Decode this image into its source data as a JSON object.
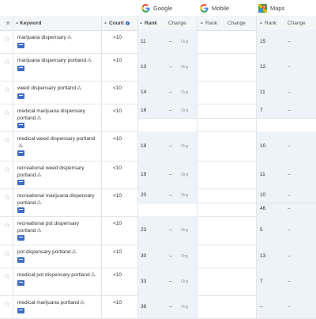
{
  "engines": [
    {
      "name": "Google",
      "icon": "google-icon"
    },
    {
      "name": "Mobile",
      "icon": "google-icon"
    },
    {
      "name": "Maps",
      "icon": "maps-icon"
    }
  ],
  "headers": {
    "keyword": "Keyword",
    "count": "Count",
    "google_rank": "Rank",
    "google_change": "Change",
    "mobile_rank": "Rank",
    "mobile_change": "Change",
    "maps_rank": "Rank",
    "maps_change": "Change"
  },
  "rows": [
    {
      "keyword": "marijuana dispensary",
      "count": "<10",
      "google_rank": "11",
      "google_change": "–",
      "google_type": "Org",
      "maps_rank": "15",
      "maps_change": "–"
    },
    {
      "keyword": "marijuana dispensary portland",
      "count": "<10",
      "google_rank": "13",
      "google_change": "–",
      "google_type": "Org",
      "maps_rank": "12",
      "maps_change": "–"
    },
    {
      "keyword": "weed dispensary portland",
      "count": "<10",
      "google_rank": "14",
      "google_change": "–",
      "google_type": "Org",
      "maps_rank": "11",
      "maps_change": "–"
    },
    {
      "keyword": "medical marijuana dispensary portland",
      "count": "<10",
      "google_rank": "16",
      "google_change": "–",
      "google_type": "Org",
      "maps_rank": "7",
      "maps_change": "–"
    },
    {
      "keyword": "medical weed dispensary portland",
      "count": "<10",
      "google_rank": "18",
      "google_change": "–",
      "google_type": "Org",
      "maps_rank": "10",
      "maps_change": "–"
    },
    {
      "keyword": "recreational weed dispensary portland",
      "count": "<10",
      "google_rank": "19",
      "google_change": "–",
      "google_type": "Org",
      "maps_rank": "11",
      "maps_change": "–"
    },
    {
      "keyword": "recreational marijuana dispensary portland",
      "count": "<10",
      "google_rank": "20",
      "google_change": "–",
      "google_type": "Org",
      "maps_rank": "10",
      "maps_change": "–",
      "maps_rank2": "46",
      "maps_change2": "–"
    },
    {
      "keyword": "recreational pot dispensary portland",
      "count": "<10",
      "google_rank": "23",
      "google_change": "–",
      "google_type": "Org",
      "maps_rank": "5",
      "maps_change": "–"
    },
    {
      "keyword": "pot dispensary portland",
      "count": "<10",
      "google_rank": "30",
      "google_change": "–",
      "google_type": "Org",
      "maps_rank": "13",
      "maps_change": "–"
    },
    {
      "keyword": "medical pot dispensary portland",
      "count": "<10",
      "google_rank": "33",
      "google_change": "–",
      "google_type": "Org",
      "maps_rank": "7",
      "maps_change": "–"
    },
    {
      "keyword": "medical marijuana portland",
      "count": "<10",
      "google_rank": "38",
      "google_change": "–",
      "google_type": "Org",
      "maps_rank": "–",
      "maps_change": "–"
    }
  ],
  "colors": {
    "google_blue": "#4285f4",
    "google_red": "#ea4335",
    "google_yellow": "#fbbc05",
    "google_green": "#34a853",
    "shade": "#eef3fa"
  }
}
